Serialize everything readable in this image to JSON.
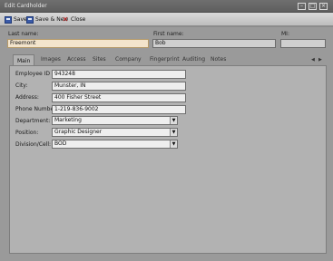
{
  "window": {
    "title": "Edit Cardholder"
  },
  "toolbar": {
    "save_label": "Save",
    "save_new_label": "Save & New",
    "close_label": "Close"
  },
  "name": {
    "last_label": "Last name:",
    "last_value": "Freemont",
    "first_label": "First name:",
    "first_value": "Bob",
    "mi_label": "MI:",
    "mi_value": ""
  },
  "tabs": [
    {
      "label": "Main"
    },
    {
      "label": "Images"
    },
    {
      "label": "Access"
    },
    {
      "label": "Sites"
    },
    {
      "label": "Company"
    },
    {
      "label": "Fingerprint"
    },
    {
      "label": "Auditing"
    },
    {
      "label": "Notes"
    }
  ],
  "main": {
    "employee_id_label": "Employee ID #:",
    "employee_id": "943248",
    "city_label": "City:",
    "city": "Munster, IN",
    "address_label": "Address:",
    "address": "400 Fisher Street",
    "phone_label": "Phone Number:",
    "phone": "1-219-836-9002",
    "department_label": "Department:",
    "department": "Marketing",
    "position_label": "Position:",
    "position": "Graphic Designer",
    "division_label": "Division/Cell:",
    "division": "BOD"
  },
  "icons": {
    "save": "save-disk-icon",
    "save_new": "save-new-icon",
    "close": "close-x-icon"
  }
}
